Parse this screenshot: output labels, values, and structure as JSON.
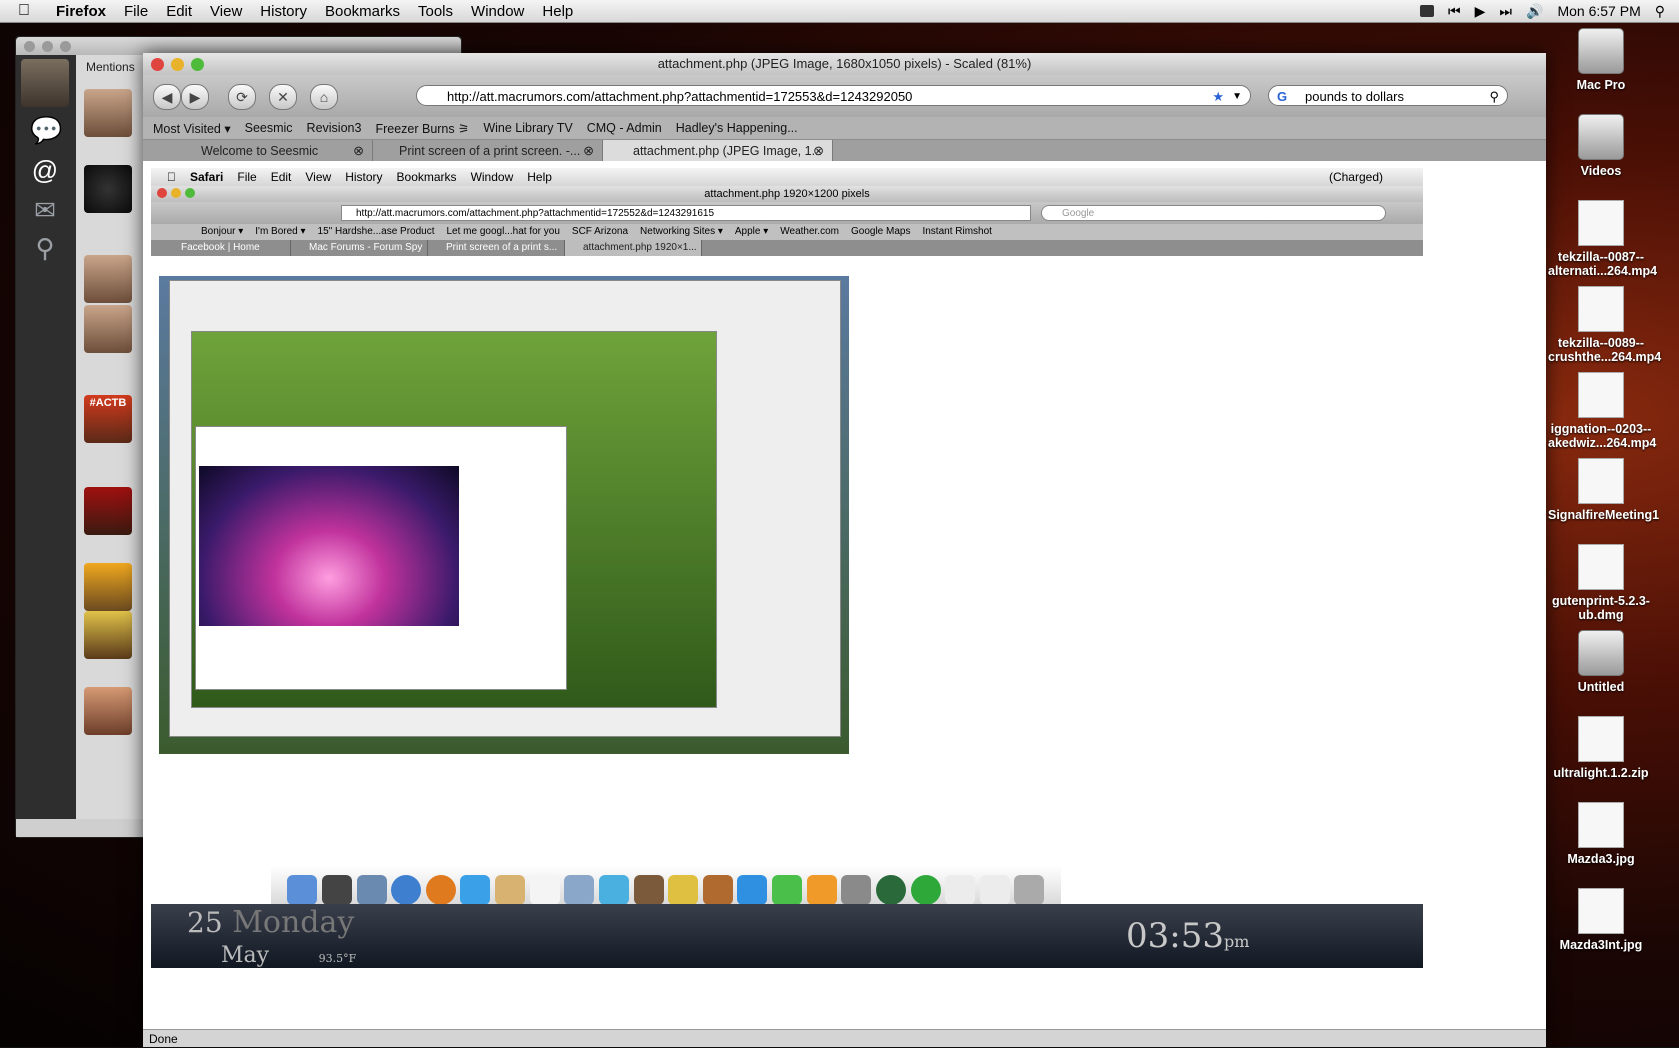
{
  "menubar": {
    "app": "Firefox",
    "items": [
      "File",
      "Edit",
      "View",
      "History",
      "Bookmarks",
      "Tools",
      "Window",
      "Help"
    ],
    "clock": "Mon 6:57 PM"
  },
  "seesmic": {
    "section": "Mentions",
    "avatar_tag": "#ACTB"
  },
  "firefox": {
    "title": "attachment.php (JPEG Image, 1680x1050 pixels) - Scaled (81%)",
    "url": "http://att.macrumors.com/attachment.php?attachmentid=172553&d=1243292050",
    "search_value": "pounds to dollars",
    "bookmarks": [
      "Most Visited ▾",
      "Seesmic",
      "Revision3",
      "Freezer Burns ⚞",
      "Wine Library TV",
      "CMQ - Admin",
      "Hadley's Happening..."
    ],
    "tabs": [
      "Welcome to Seesmic",
      "Print screen of a print screen. -...",
      "attachment.php (JPEG Image, 1..."
    ],
    "status": "Done"
  },
  "screenshot": {
    "menubar_app": "Safari",
    "menubar_items": [
      "File",
      "Edit",
      "View",
      "History",
      "Bookmarks",
      "Window",
      "Help"
    ],
    "status_right": "(Charged)",
    "window_title": "attachment.php 1920×1200 pixels",
    "url": "http://att.macrumors.com/attachment.php?attachmentid=172552&d=1243291615",
    "search_placeholder": "Google",
    "bookmarks": [
      "Bonjour ▾",
      "I'm Bored ▾",
      "15\" Hardshe...ase Product",
      "Let me googl...hat for you",
      "SCF Arizona",
      "Networking Sites ▾",
      "Apple ▾",
      "Weather.com",
      "Google Maps",
      "Instant Rimshot"
    ],
    "tabs": [
      "Facebook | Home",
      "Mac Forums - Forum Spy",
      "Print screen of a print s...",
      "attachment.php 1920×1..."
    ],
    "widget_day": "25",
    "widget_weekday": "Monday",
    "widget_month": "May",
    "widget_temp": "93.5°F",
    "widget_time": "03:53",
    "widget_ampm": "pm"
  },
  "desktop_icons": [
    {
      "label": "Mac Pro",
      "kind": "drive"
    },
    {
      "label": "Videos",
      "kind": "drive"
    },
    {
      "label": "tekzilla--0087--\nalternati...264.mp4",
      "kind": "doc"
    },
    {
      "label": "tekzilla--0089--\ncrushthe...264.mp4",
      "kind": "doc"
    },
    {
      "label": "iggnation--0203--\nakedwiz...264.mp4",
      "kind": "doc"
    },
    {
      "label": "SignalfireMeeting1",
      "kind": "doc"
    },
    {
      "label": "gutenprint-5.2.3-\nub.dmg",
      "kind": "doc"
    },
    {
      "label": "Untitled",
      "kind": "drive"
    },
    {
      "label": "ultralight.1.2.zip",
      "kind": "doc"
    },
    {
      "label": "Mazda3.jpg",
      "kind": "doc"
    },
    {
      "label": "Mazda3Int.jpg",
      "kind": "doc"
    }
  ]
}
